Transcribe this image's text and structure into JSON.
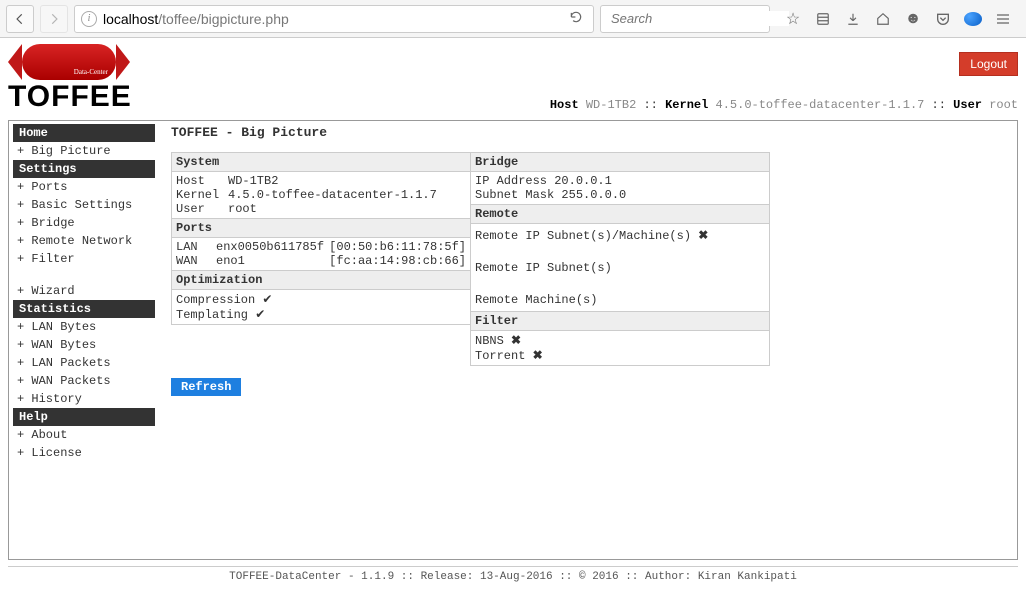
{
  "browser": {
    "url_host": "localhost",
    "url_path": "/toffee/bigpicture.php",
    "search_placeholder": "Search"
  },
  "app": {
    "logo_sub": "Data-Center",
    "logo_text": "TOFFEE",
    "logout": "Logout",
    "status": {
      "host_label": "Host",
      "host_value": "WD-1TB2",
      "kernel_label": "Kernel",
      "kernel_value": "4.5.0-toffee-datacenter-1.1.7",
      "user_label": "User",
      "user_value": "root"
    }
  },
  "nav": {
    "home": "Home",
    "big_picture": "Big Picture",
    "settings": "Settings",
    "ports": "Ports",
    "basic_settings": "Basic Settings",
    "bridge": "Bridge",
    "remote_network": "Remote Network",
    "filter": "Filter",
    "wizard": "Wizard",
    "statistics": "Statistics",
    "lan_bytes": "LAN Bytes",
    "wan_bytes": "WAN Bytes",
    "lan_packets": "LAN Packets",
    "wan_packets": "WAN Packets",
    "history": "History",
    "help": "Help",
    "about": "About",
    "license": "License"
  },
  "main": {
    "title": "TOFFEE - Big Picture",
    "system": {
      "title": "System",
      "host_k": "Host",
      "host_v": "WD-1TB2",
      "kernel_k": "Kernel",
      "kernel_v": "4.5.0-toffee-datacenter-1.1.7",
      "user_k": "User",
      "user_v": "root"
    },
    "ports": {
      "title": "Ports",
      "lan_k": "LAN",
      "lan_if": "enx0050b611785f",
      "lan_mac": "[00:50:b6:11:78:5f]",
      "wan_k": "WAN",
      "wan_if": "eno1",
      "wan_mac": "[fc:aa:14:98:cb:66]"
    },
    "optim": {
      "title": "Optimization",
      "compression": "Compression",
      "templating": "Templating"
    },
    "bridge": {
      "title": "Bridge",
      "ip_k": "IP Address",
      "ip_v": "20.0.0.1",
      "mask_k": "Subnet Mask",
      "mask_v": "255.0.0.0"
    },
    "remote": {
      "title": "Remote",
      "l1": "Remote IP Subnet(s)/Machine(s)",
      "l2": "Remote IP Subnet(s)",
      "l3": "Remote Machine(s)"
    },
    "filter": {
      "title": "Filter",
      "nbns": "NBNS",
      "torrent": "Torrent"
    },
    "refresh": "Refresh"
  },
  "footer": "TOFFEE-DataCenter - 1.1.9 :: Release: 13-Aug-2016 :: © 2016 :: Author: Kiran Kankipati"
}
